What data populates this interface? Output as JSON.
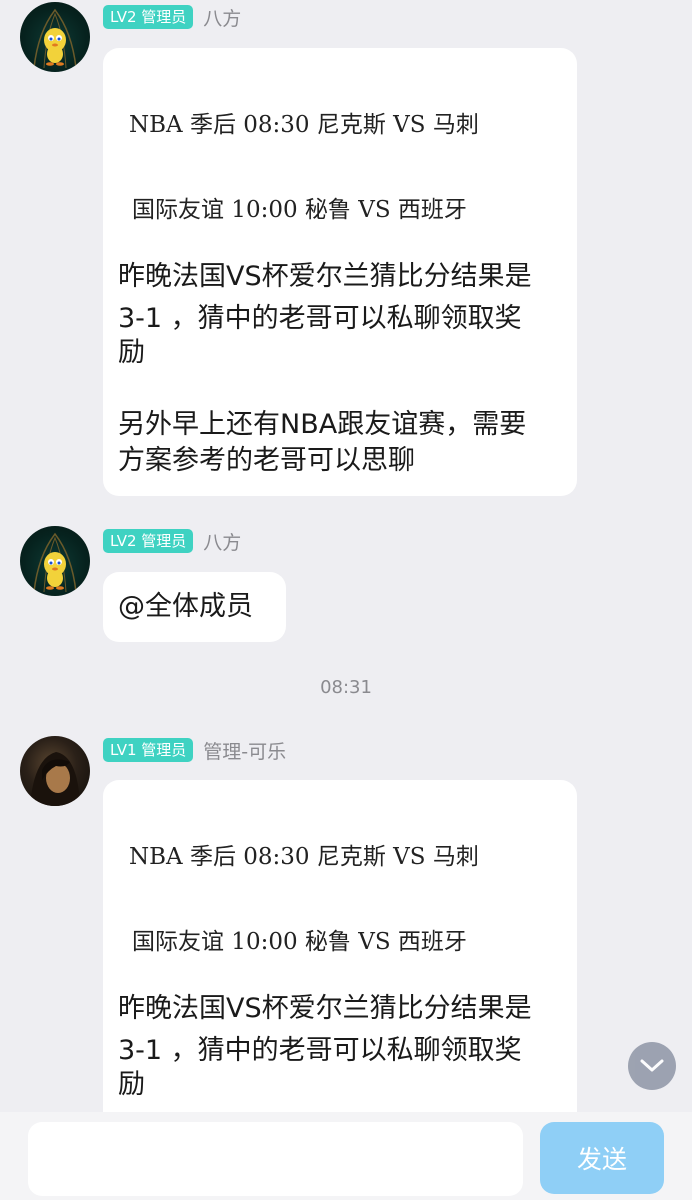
{
  "messages": [
    {
      "badge": "LV2 管理员",
      "sender": "八方",
      "lines_serif": [
        "NBA 季后 08:30 尼克斯 VS 马刺",
        "国际友谊 10:00 秘鲁 VS 西班牙"
      ],
      "lines_sans": [
        "昨晚法国VS杯爱尔兰猜比分结果是",
        "3-1 ，猜中的老哥可以私聊领取奖",
        "励",
        "另外早上还有NBA跟友谊赛，需要",
        "方案参考的老哥可以思聊"
      ]
    },
    {
      "badge": "LV2 管理员",
      "sender": "八方",
      "text": "@全体成员"
    },
    {
      "badge": "LV1 管理员",
      "sender": "管理-可乐",
      "lines_serif": [
        "NBA 季后 08:30 尼克斯 VS 马刺",
        "国际友谊 10:00 秘鲁 VS 西班牙"
      ],
      "lines_sans": [
        "昨晚法国VS杯爱尔兰猜比分结果是",
        "3-1 ，猜中的老哥可以私聊领取奖",
        "励"
      ]
    }
  ],
  "timestamp": "08:31",
  "composer": {
    "placeholder": "",
    "send_label": "发送"
  },
  "icons": {
    "scroll_down": "chevron-down-icon"
  }
}
